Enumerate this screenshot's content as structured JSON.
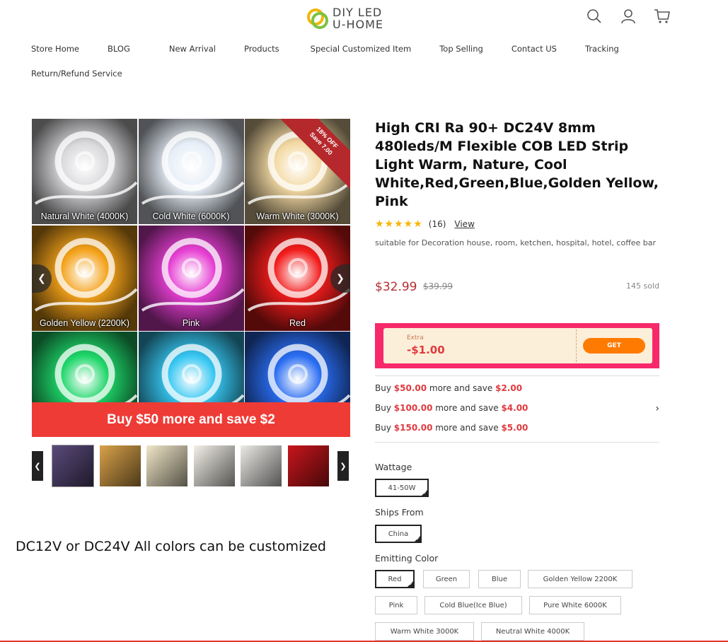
{
  "header": {
    "logo_line1": "DIY LED",
    "logo_line2": "U-HOME",
    "icons": [
      "search-icon",
      "user-icon",
      "cart-icon"
    ]
  },
  "nav": {
    "items": [
      "Store Home",
      "BLOG",
      "New Arrival",
      "Products",
      "Special Customized Item",
      "Top Selling",
      "Contact US",
      "Tracking"
    ],
    "row2": [
      "Return/Refund Service"
    ]
  },
  "gallery": {
    "tiles": [
      {
        "label": "Natural White (4000K)",
        "color": "#d9d9dc"
      },
      {
        "label": "Cold White (6000K)",
        "color": "#e6eef7"
      },
      {
        "label": "Warm White (3000K)",
        "color": "#f3d9a3"
      },
      {
        "label": "Golden Yellow (2200K)",
        "color": "#f4a21a"
      },
      {
        "label": "Pink",
        "color": "#e63fd3"
      },
      {
        "label": "Red",
        "color": "#f21c1c"
      },
      {
        "label": "",
        "color": "#1fd66a"
      },
      {
        "label": "",
        "color": "#37c7f2"
      },
      {
        "label": "",
        "color": "#2a6df2"
      }
    ],
    "badge_line1": "18% OFF",
    "badge_line2": "Save 7.00",
    "promo": "Buy $50 more and save $2",
    "thumb_colors": [
      "#5a4a7a",
      "#d9a24a",
      "#f1e6c8",
      "#f3f0e8",
      "#ebeae6",
      "#c8161c"
    ]
  },
  "note": "DC12V or DC24V All colors can be customized",
  "product": {
    "title": "High CRI Ra 90+ DC24V 8mm 480leds/M Flexible COB LED Strip Light Warm, Nature, Cool White,Red,Green,Blue,Golden Yellow, Pink",
    "stars": "★★★★★",
    "rating": 5,
    "review_count": "(16)",
    "view_label": "View",
    "description": "suitable for Decoration house, room, ketchen, hospital, hotel, coffee bar",
    "price": "$32.99",
    "old_price": "$39.99",
    "sold": "145 sold"
  },
  "coupon": {
    "extra": "Extra",
    "amount": "-$1.00",
    "button": "GET"
  },
  "savings": [
    {
      "pre": "Buy ",
      "a": "$50.00",
      "mid": " more and save ",
      "b": "$2.00"
    },
    {
      "pre": "Buy ",
      "a": "$100.00",
      "mid": " more and save ",
      "b": "$4.00"
    },
    {
      "pre": "Buy ",
      "a": "$150.00",
      "mid": " more and save ",
      "b": "$5.00"
    }
  ],
  "options": {
    "wattage_label": "Wattage",
    "wattage": [
      "41-50W"
    ],
    "ships_label": "Ships From",
    "ships": [
      "China"
    ],
    "color_label": "Emitting Color",
    "colors": [
      "Red",
      "Green",
      "Blue",
      "Golden Yellow 2200K",
      "Pink",
      "Cold Blue(Ice Blue)",
      "Pure White 6000K",
      "Warm White 3000K",
      "Neutral White 4000K"
    ]
  }
}
